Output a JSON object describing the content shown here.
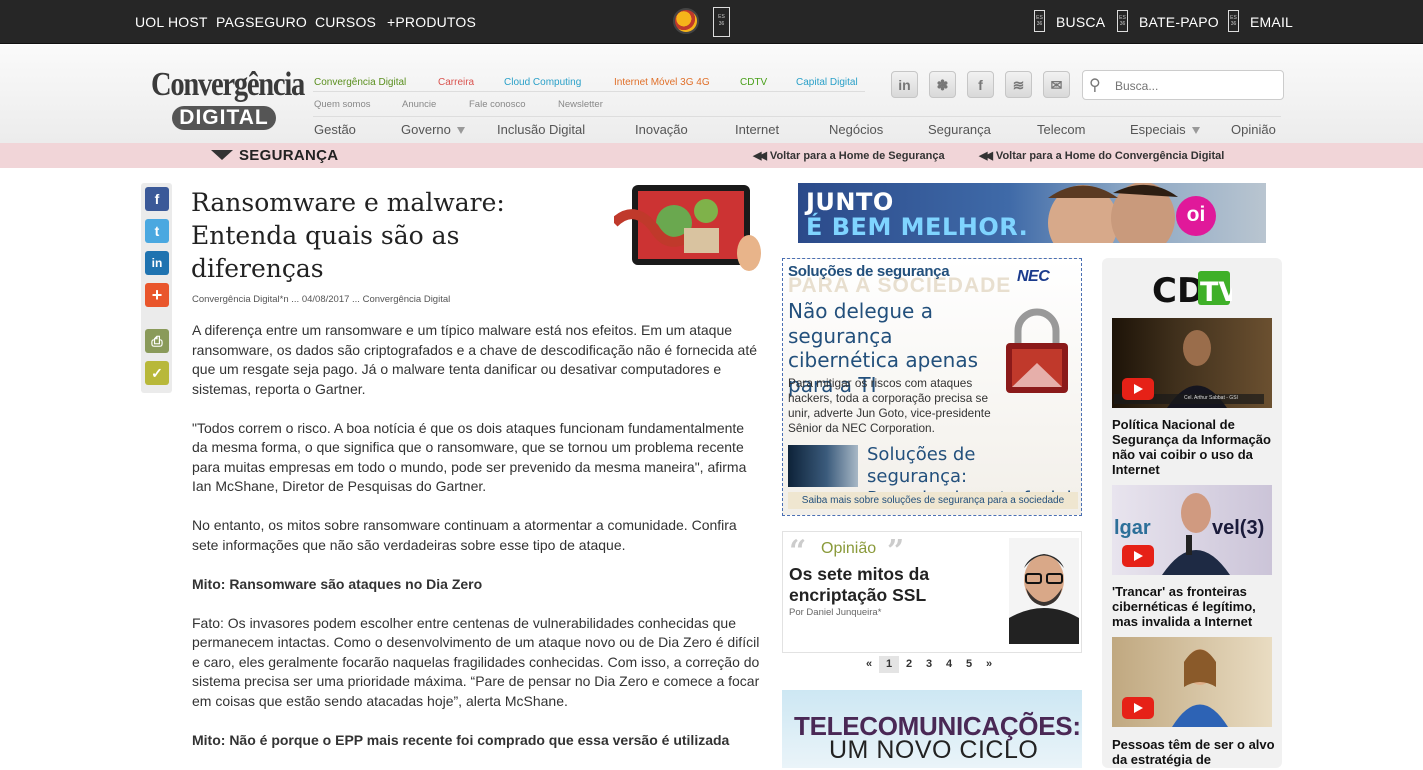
{
  "topbar": {
    "links": [
      "UOL HOST",
      "PAGSEGURO",
      "CURSOS",
      "+PRODUTOS"
    ],
    "right": [
      "BUSCA",
      "BATE-PAPO",
      "EMAIL"
    ]
  },
  "header": {
    "logo_line1": "Convergência",
    "logo_line2": "DIGITAL",
    "sublinks": [
      {
        "label": "Convergência Digital",
        "color": "#5a8f1e"
      },
      {
        "label": "Carreira",
        "color": "#d9534f"
      },
      {
        "label": "Cloud Computing",
        "color": "#2aa0c8"
      },
      {
        "label": "Internet Móvel 3G 4G",
        "color": "#e0702a"
      },
      {
        "label": "CDTV",
        "color": "#4aa01a"
      },
      {
        "label": "Capital Digital",
        "color": "#2aa0c8"
      }
    ],
    "utility": [
      "Quem somos",
      "Anuncie",
      "Fale conosco",
      "Newsletter"
    ],
    "nav": [
      "Gestão",
      "Governo",
      "Inclusão Digital",
      "Inovação",
      "Internet",
      "Negócios",
      "Segurança",
      "Telecom",
      "Especiais",
      "Opinião"
    ],
    "social_icons": [
      "linkedin-icon",
      "twitter-icon",
      "facebook-icon",
      "rss-icon",
      "email-icon"
    ],
    "search_placeholder": "Busca..."
  },
  "section": {
    "name": "SEGURANÇA",
    "back1": "Voltar para a Home de Segurança",
    "back2": "Voltar para a Home do Convergência Digital"
  },
  "share": [
    "facebook-share-icon",
    "twitter-share-icon",
    "linkedin-share-icon",
    "more-share-icon",
    "print-icon",
    "save-icon"
  ],
  "article": {
    "title": "Ransomware e malware: Entenda quais são as diferenças",
    "meta": "Convergência Digital*n ... 04/08/2017 ... Convergência Digital",
    "paragraphs": [
      {
        "text": "A diferença entre um ransomware e um típico malware está nos efeitos. Em um ataque ransomware, os dados são criptografados e a chave de descodificação não é fornecida até que um resgate seja pago. Já o malware tenta danificar ou desativar computadores e sistemas, reporta o Gartner.",
        "bold": false
      },
      {
        "text": "\"Todos correm o risco. A boa notícia é que os dois ataques funcionam fundamentalmente da mesma forma, o que significa que o ransomware, que se tornou um problema recente para muitas empresas em todo o mundo, pode ser prevenido da mesma maneira\", afirma Ian McShane, Diretor de Pesquisas do Gartner.",
        "bold": false
      },
      {
        "text": "No entanto, os mitos sobre ransomware continuam a atormentar a comunidade. Confira sete informações que não são verdadeiras sobre esse tipo de ataque.",
        "bold": false
      },
      {
        "text": "Mito: Ransomware são ataques no Dia Zero",
        "bold": true
      },
      {
        "text": "Fato: Os invasores podem escolher entre centenas de vulnerabilidades conhecidas que permanecem intactas. Como o desenvolvimento de um ataque novo ou de Dia Zero é difícil e caro, eles geralmente focarão naquelas fragilidades conhecidas. Com isso, a correção do sistema precisa ser uma prioridade máxima. “Pare de pensar no Dia Zero e comece a focar em coisas que estão sendo atacadas hoje”, alerta McShane.",
        "bold": false
      },
      {
        "text": "Mito: Não é porque o EPP mais recente foi comprado que essa versão é utilizada",
        "bold": true
      }
    ]
  },
  "ad_oi": {
    "line1": "JUNTO",
    "line2": "É BEM MELHOR.",
    "brand": "oi"
  },
  "nec_box": {
    "heading": "Soluções de segurança",
    "ghost": "PARA A SOCIEDADE",
    "brand": "NEC",
    "title": "Não delegue a segurança cibernética apenas para a TI",
    "text": "Para mitigar os riscos com ataques hackers, toda a corporação precisa se unir, adverte Jun Goto, vice-presidente Sênior da NEC Corporation.",
    "title2": "Soluções de segurança: Reconhecimento facial",
    "footer": "Saiba mais sobre soluções de segurança para a sociedade"
  },
  "opiniao": {
    "label": "Opinião",
    "title": "Os sete mitos da encriptação SSL",
    "author": "Por Daniel Junqueira*"
  },
  "pager": [
    "«",
    "1",
    "2",
    "3",
    "4",
    "5",
    "»"
  ],
  "tele_ad": {
    "line1": "TELECOMUNICAÇÕES:",
    "line2": "UM NOVO CICLO"
  },
  "cdtv": {
    "logo": "CDTV",
    "videos": [
      {
        "title": "Política Nacional de Segurança da Informação não vai coibir o uso da Internet"
      },
      {
        "title": "'Trancar' as fronteiras cibernéticas é legítimo, mas invalida a Internet"
      },
      {
        "title": "Pessoas têm de ser o alvo da estratégia de"
      }
    ],
    "caption1": "Cel. Arthur Sabbat - GSI",
    "overlay2": "lgar",
    "overlay2b": "vel(3)"
  }
}
